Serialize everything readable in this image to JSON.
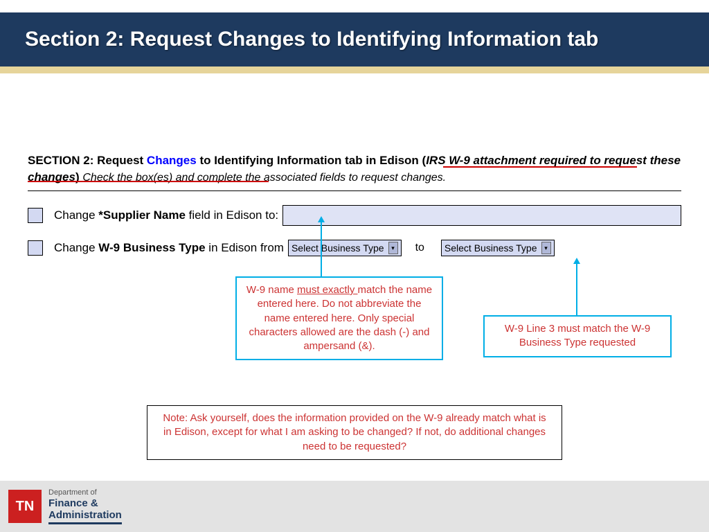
{
  "header": {
    "title": "Section 2: Request Changes to Identifying Information tab"
  },
  "section_heading": {
    "prefix": "SECTION 2: Request ",
    "changes_word": "Changes",
    "mid": " to Identifying Information tab in Edison (",
    "emphasis": "IRS W-9 attachment required to request these changes",
    "close_paren": ") ",
    "instruction": "Check the box(es) and complete the associated fields to request changes."
  },
  "row1": {
    "pre": "Change ",
    "bold": "*Supplier Name",
    "post": " field in Edison to:",
    "input_value": ""
  },
  "row2": {
    "pre": "Change ",
    "bold": "W-9 Business Type",
    "post": " in Edison from",
    "dropdown_from": "Select Business Type",
    "to_label": "to",
    "dropdown_to": "Select Business Type"
  },
  "callout1": {
    "pre": "W-9 name ",
    "underlined": "must exactly ",
    "post": "match the name entered here. Do not abbreviate the name entered here. Only special characters allowed are the dash (-) and ampersand (&)."
  },
  "callout2": {
    "text": "W-9 Line 3 must match the W-9 Business Type requested"
  },
  "note": {
    "text": "Note: Ask yourself, does the information provided on the W-9 already match what is in Edison, except for what I am asking to be changed? If not, do additional changes need to be requested?"
  },
  "footer": {
    "logo": "TN",
    "line1": "Department of",
    "line2": "Finance &",
    "line3": "Administration"
  },
  "colors": {
    "header_bg": "#1e3a5f",
    "gold": "#e6d49a",
    "callout_border": "#00aee6",
    "callout_text": "#cc3333",
    "link_blue": "#0000ff",
    "red_underline": "#cc0000",
    "logo_bg": "#cc2020"
  }
}
